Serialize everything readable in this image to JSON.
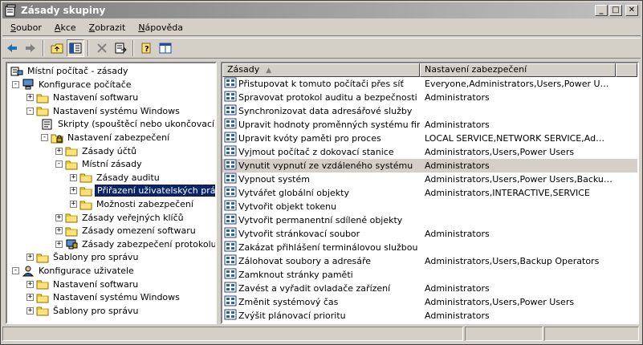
{
  "window": {
    "title": "Zásady skupiny"
  },
  "menu": [
    {
      "label_u": "S",
      "label_rest": "oubor"
    },
    {
      "label_u": "A",
      "label_rest": "kce"
    },
    {
      "label_u": "Z",
      "label_rest": "obrazit"
    },
    {
      "label_u": "N",
      "label_rest": "ápověda"
    }
  ],
  "tree": [
    {
      "label": "Místní počítač - zásady",
      "level": 0,
      "expander": "",
      "icon": "computer-policy-icon"
    },
    {
      "label": "Konfigurace počítače",
      "level": 1,
      "expander": "-",
      "icon": "computer-icon"
    },
    {
      "label": "Nastavení softwaru",
      "level": 2,
      "expander": "+",
      "icon": "folder-icon"
    },
    {
      "label": "Nastavení systému Windows",
      "level": 2,
      "expander": "-",
      "icon": "folder-icon"
    },
    {
      "label": "Skripty (spouštěcí nebo ukončovací)",
      "level": 3,
      "expander": "",
      "icon": "script-icon"
    },
    {
      "label": "Nastavení zabezpečení",
      "level": 3,
      "expander": "-",
      "icon": "security-icon"
    },
    {
      "label": "Zásady účtů",
      "level": 4,
      "expander": "+",
      "icon": "folder-icon"
    },
    {
      "label": "Místní zásady",
      "level": 4,
      "expander": "-",
      "icon": "folder-icon"
    },
    {
      "label": "Zásady auditu",
      "level": 5,
      "expander": "+",
      "icon": "folder-icon"
    },
    {
      "label": "Přiřazení uživatelských práv",
      "level": 5,
      "expander": "+",
      "icon": "folder-icon",
      "selected": true
    },
    {
      "label": "Možnosti zabezpečení",
      "level": 5,
      "expander": "+",
      "icon": "folder-icon"
    },
    {
      "label": "Zásady veřejných klíčů",
      "level": 4,
      "expander": "+",
      "icon": "folder-icon"
    },
    {
      "label": "Zásady omezení softwaru",
      "level": 4,
      "expander": "+",
      "icon": "folder-icon"
    },
    {
      "label": "Zásady zabezpečení protokolu IP",
      "level": 4,
      "expander": "+",
      "icon": "ipsec-icon"
    },
    {
      "label": "Šablony pro správu",
      "level": 2,
      "expander": "+",
      "icon": "folder-icon"
    },
    {
      "label": "Konfigurace uživatele",
      "level": 1,
      "expander": "-",
      "icon": "user-icon"
    },
    {
      "label": "Nastavení softwaru",
      "level": 2,
      "expander": "+",
      "icon": "folder-icon"
    },
    {
      "label": "Nastavení systému Windows",
      "level": 2,
      "expander": "+",
      "icon": "folder-icon"
    },
    {
      "label": "Šablony pro správu",
      "level": 2,
      "expander": "+",
      "icon": "folder-icon"
    }
  ],
  "list": {
    "headers": {
      "policy": "Zásady",
      "setting": "Nastavení zabezpečení"
    },
    "rows": [
      {
        "policy": "Přistupovat k tomuto počítači přes síť",
        "setting": "Everyone,Administrators,Users,Power Users,Ba..."
      },
      {
        "policy": "Spravovat protokol auditu a bezpečnosti",
        "setting": "Administrators"
      },
      {
        "policy": "Synchronizovat data adresářové služby",
        "setting": ""
      },
      {
        "policy": "Upravit hodnoty proměnných systému firmware",
        "setting": "Administrators"
      },
      {
        "policy": "Upravit kvóty paměti pro proces",
        "setting": "LOCAL SERVICE,NETWORK SERVICE,Admini..."
      },
      {
        "policy": "Vyjmout počítač z dokovací stanice",
        "setting": "Administrators,Users,Power Users"
      },
      {
        "policy": "Vynutit vypnutí ze vzdáleného systému",
        "setting": "Administrators",
        "selected": true
      },
      {
        "policy": "Vypnout systém",
        "setting": "Administrators,Users,Power Users,Backup Oper..."
      },
      {
        "policy": "Vytvářet globální objekty",
        "setting": "Administrators,INTERACTIVE,SERVICE"
      },
      {
        "policy": "Vytvořit objekt tokenu",
        "setting": ""
      },
      {
        "policy": "Vytvořit permanentní sdílené objekty",
        "setting": ""
      },
      {
        "policy": "Vytvořit stránkovací soubor",
        "setting": "Administrators"
      },
      {
        "policy": "Zakázat přihlášení terminálovou službou",
        "setting": ""
      },
      {
        "policy": "Zálohovat soubory a adresáře",
        "setting": "Administrators,Users,Backup Operators"
      },
      {
        "policy": "Zamknout stránky paměti",
        "setting": ""
      },
      {
        "policy": "Zavést a vyřadit ovladače zařízení",
        "setting": "Administrators"
      },
      {
        "policy": "Změnit systémový čas",
        "setting": "Administrators,Users,Power Users"
      },
      {
        "policy": "Zvýšit plánovací prioritu",
        "setting": "Administrators"
      }
    ]
  },
  "colors": {
    "selection": "#0a246a",
    "face": "#d4d0c8",
    "titlebar_start": "#808080",
    "titlebar_end": "#c0c0c0"
  }
}
